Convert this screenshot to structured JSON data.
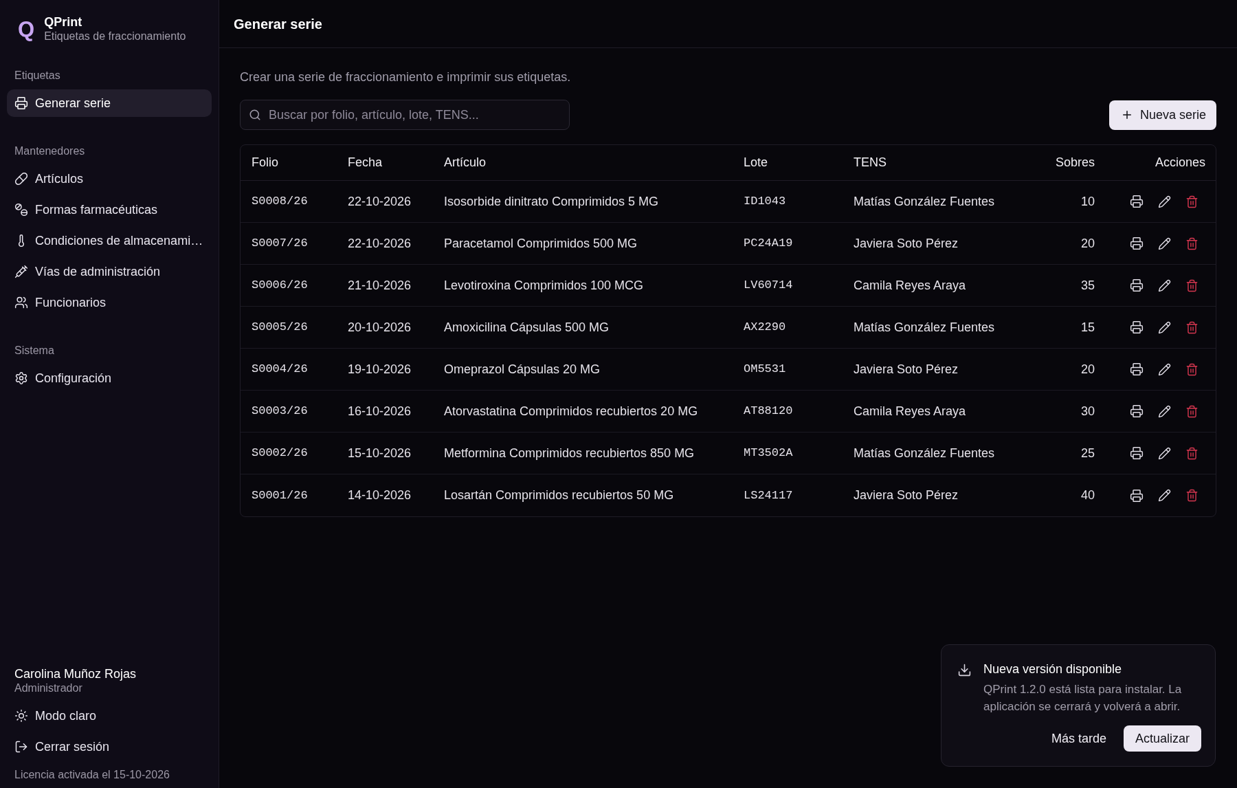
{
  "app": {
    "logo": "Q",
    "name": "QPrint",
    "subtitle": "Etiquetas de fraccionamiento"
  },
  "sidebar": {
    "sections": [
      {
        "title": "Etiquetas",
        "items": [
          {
            "label": "Generar serie",
            "selected": true
          }
        ]
      },
      {
        "title": "Mantenedores",
        "items": [
          {
            "label": "Artículos",
            "selected": false
          },
          {
            "label": "Formas farmacéuticas",
            "selected": false
          },
          {
            "label": "Condiciones de almacenami…",
            "selected": false
          },
          {
            "label": "Vías de administración",
            "selected": false
          },
          {
            "label": "Funcionarios",
            "selected": false
          }
        ]
      },
      {
        "title": "Sistema",
        "items": [
          {
            "label": "Configuración",
            "selected": false
          }
        ]
      }
    ],
    "user": {
      "name": "Carolina Muñoz Rojas",
      "role": "Administrador"
    },
    "actions": [
      "Modo claro",
      "Cerrar sesión"
    ],
    "license": "Licencia activada el 15-10-2026"
  },
  "header": {
    "title": "Generar serie"
  },
  "description": "Crear una serie de fraccionamiento e imprimir sus etiquetas.",
  "search": {
    "placeholder": "Buscar por folio, artículo, lote, TENS..."
  },
  "new_button": "Nueva serie",
  "table": {
    "columns": [
      "Folio",
      "Fecha",
      "Artículo",
      "Lote",
      "TENS",
      "Sobres",
      "Acciones"
    ],
    "rows": [
      {
        "folio": "S0008/26",
        "fecha": "22-10-2026",
        "articulo": "Isosorbide dinitrato Comprimidos 5 MG",
        "lote": "ID1043",
        "tens": "Matías González Fuentes",
        "sobres": "10"
      },
      {
        "folio": "S0007/26",
        "fecha": "22-10-2026",
        "articulo": "Paracetamol Comprimidos 500 MG",
        "lote": "PC24A19",
        "tens": "Javiera Soto Pérez",
        "sobres": "20"
      },
      {
        "folio": "S0006/26",
        "fecha": "21-10-2026",
        "articulo": "Levotiroxina Comprimidos 100 MCG",
        "lote": "LV60714",
        "tens": "Camila Reyes Araya",
        "sobres": "35"
      },
      {
        "folio": "S0005/26",
        "fecha": "20-10-2026",
        "articulo": "Amoxicilina Cápsulas 500 MG",
        "lote": "AX2290",
        "tens": "Matías González Fuentes",
        "sobres": "15"
      },
      {
        "folio": "S0004/26",
        "fecha": "19-10-2026",
        "articulo": "Omeprazol Cápsulas 20 MG",
        "lote": "OM5531",
        "tens": "Javiera Soto Pérez",
        "sobres": "20"
      },
      {
        "folio": "S0003/26",
        "fecha": "16-10-2026",
        "articulo": "Atorvastatina Comprimidos recubiertos 20 MG",
        "lote": "AT88120",
        "tens": "Camila Reyes Araya",
        "sobres": "30"
      },
      {
        "folio": "S0002/26",
        "fecha": "15-10-2026",
        "articulo": "Metformina Comprimidos recubiertos 850 MG",
        "lote": "MT3502A",
        "tens": "Matías González Fuentes",
        "sobres": "25"
      },
      {
        "folio": "S0001/26",
        "fecha": "14-10-2026",
        "articulo": "Losartán Comprimidos recubiertos 50 MG",
        "lote": "LS24117",
        "tens": "Javiera Soto Pérez",
        "sobres": "40"
      }
    ]
  },
  "toast": {
    "title": "Nueva versión disponible",
    "message": "QPrint 1.2.0 está lista para instalar. La aplicación se cerrará y volverá a abrir.",
    "buttons": [
      {
        "label": "Más tarde",
        "kind": "ghost"
      },
      {
        "label": "Actualizar",
        "kind": "primary"
      }
    ]
  }
}
